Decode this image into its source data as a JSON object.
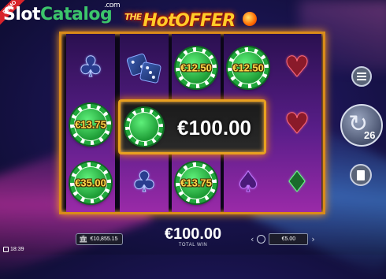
{
  "branding": {
    "demo_badge": "DEMO",
    "logo_part1": "Slot",
    "logo_part2": "Catalog",
    "logo_suffix": ".com",
    "game_title_prefix": "THE",
    "game_title": "HotOFFER"
  },
  "reels": {
    "chip_values": {
      "r2c0": "€12.50",
      "r3c0": "€12.50",
      "r0c1": "€13.75",
      "r0c2": "€35.00",
      "r2c2": "€13.75"
    },
    "symbols": {
      "r0c0": "club",
      "r1c0": "dice",
      "r4c0": "heart",
      "r4c1": "heart",
      "r1c2": "club",
      "r3c2": "spade",
      "r4c2": "diamond"
    }
  },
  "win_overlay": {
    "amount": "€100.00"
  },
  "controls": {
    "menu_icon": "hamburger-icon",
    "spin_icon": "refresh-arrow-icon",
    "autoplay_count": "26",
    "stop_icon": "stop-icon"
  },
  "footer": {
    "balance": "€10,855.15",
    "total_win_amount": "€100.00",
    "total_win_label": "TOTAL WIN",
    "bet_amount": "€5.00",
    "clock": "18:39"
  },
  "colors": {
    "chip_green": "#1fa83a",
    "chip_value_gold": "#ffd94a",
    "frame_gold": "#d98a1a",
    "title_yellow": "#ffcc2a"
  }
}
